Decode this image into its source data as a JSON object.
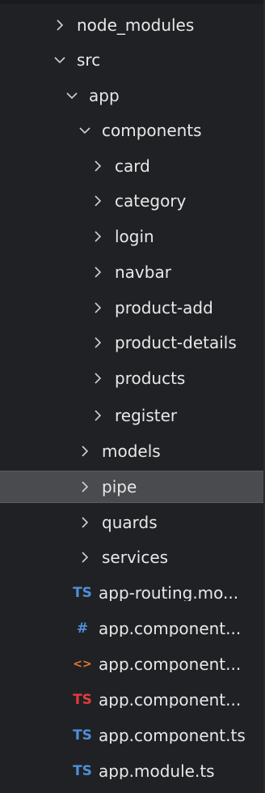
{
  "tree": {
    "node_modules": "node_modules",
    "src": "src",
    "app": "app",
    "components": "components",
    "card": "card",
    "category": "category",
    "login": "login",
    "navbar": "navbar",
    "product_add": "product-add",
    "product_details": "product-details",
    "products": "products",
    "register": "register",
    "models": "models",
    "pipe": "pipe",
    "quards": "quards",
    "services": "services",
    "files": [
      {
        "icon": "TS",
        "icon_color": "#4f8fd9",
        "label": "app-routing.mo..."
      },
      {
        "icon": "#",
        "icon_color": "#4f8fd9",
        "label": "app.component..."
      },
      {
        "icon": "<>",
        "icon_color": "#e37933",
        "label": "app.component..."
      },
      {
        "icon": "TS",
        "icon_color": "#e23c3c",
        "label": "app.component..."
      },
      {
        "icon": "TS",
        "icon_color": "#4f8fd9",
        "label": "app.component.ts"
      },
      {
        "icon": "TS",
        "icon_color": "#4f8fd9",
        "label": "app.module.ts"
      }
    ]
  },
  "colors": {
    "background": "#202124",
    "selected": "#4a4b4e",
    "text": "#e8e8e8"
  }
}
